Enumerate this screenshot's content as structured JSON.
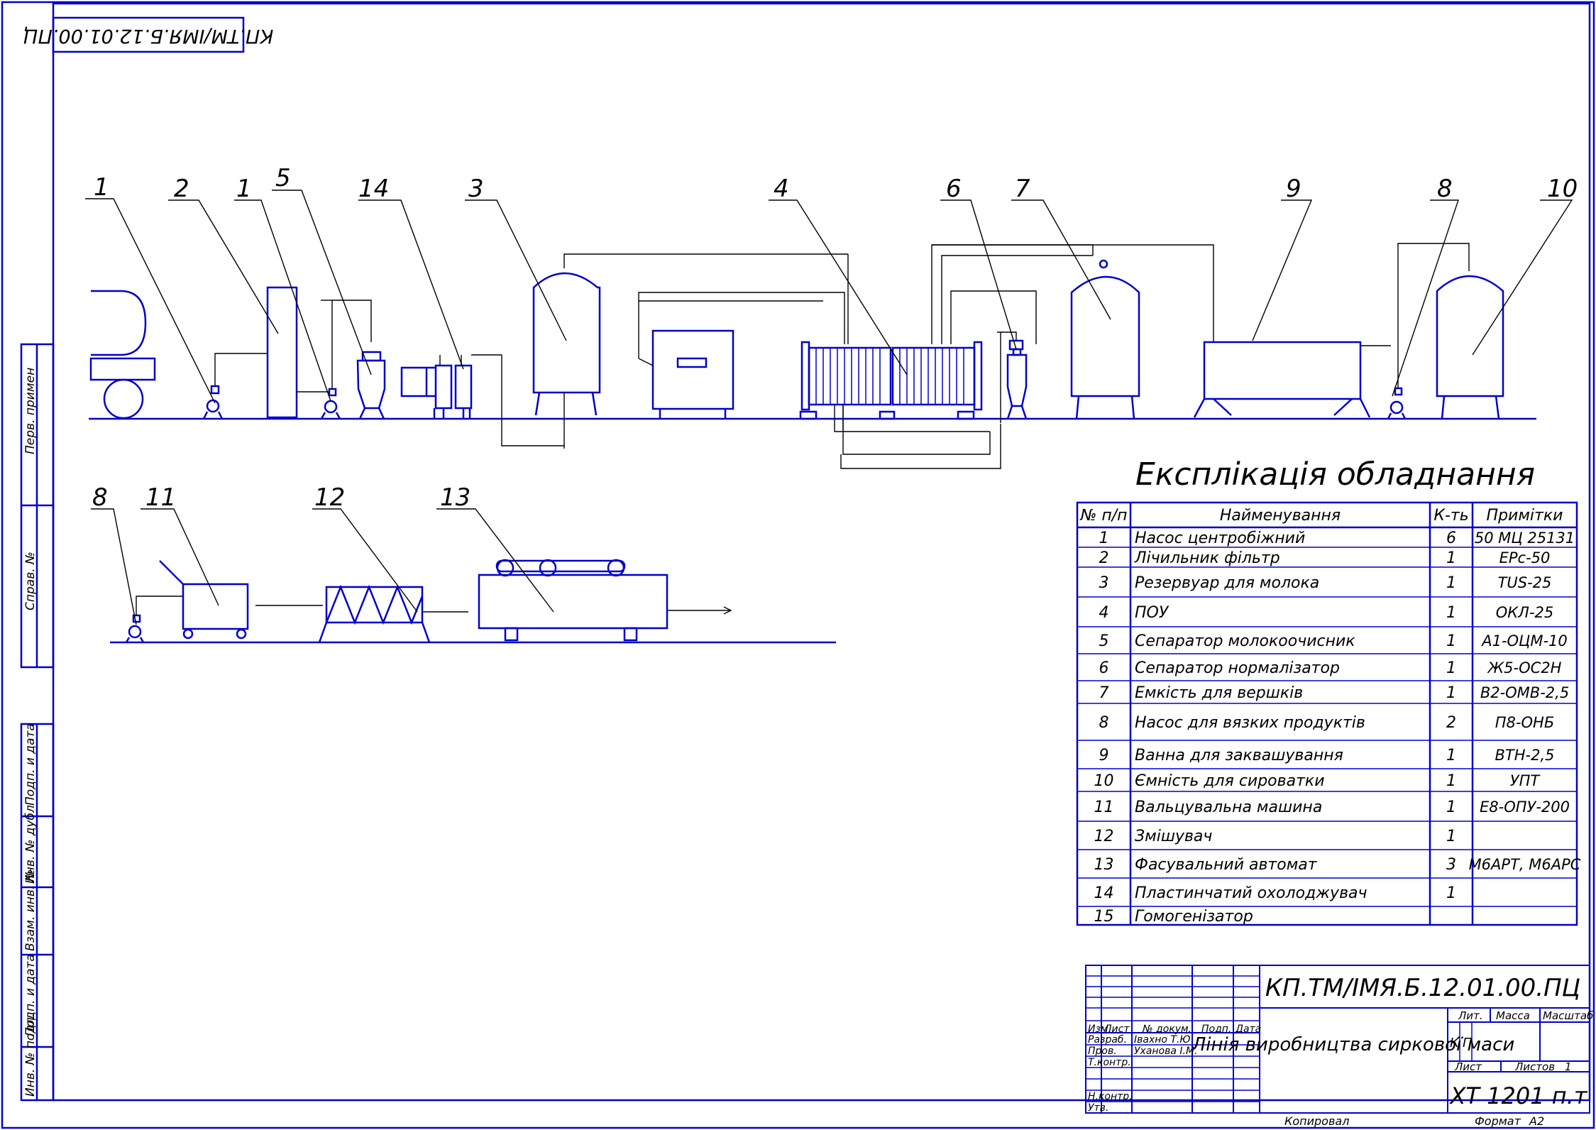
{
  "drawing": {
    "top_stamp": "КП.ТМ/ІМЯ.Б.12.01.00.ПЦ",
    "side_labels": [
      "Перв. примен",
      "Справ. №",
      "Подп. и дата",
      "Инв. № дубл",
      "Взам. инв. №",
      "Подп. и дата",
      "Инв. № подл."
    ],
    "callouts_row1": [
      "1",
      "2",
      "1",
      "5",
      "14",
      "3",
      "4",
      "6",
      "7",
      "9",
      "8",
      "10"
    ],
    "callouts_row2": [
      "8",
      "11",
      "12",
      "13"
    ],
    "footer_copied": "Копировал",
    "footer_format": "Формат",
    "footer_format_value": "А2"
  },
  "legend": {
    "title": "Експлікація обладнання",
    "headers": [
      "№ п/п",
      "Найменування",
      "К-ть",
      "Примітки"
    ],
    "rows": [
      {
        "n": "1",
        "name": "Насос центробіжний",
        "qty": "6",
        "note": "50 МЦ 25131"
      },
      {
        "n": "2",
        "name": "Лічильник фільтр",
        "qty": "1",
        "note": "ЕРс-50"
      },
      {
        "n": "3",
        "name": "Резервуар для молока",
        "qty": "1",
        "note": "TUS-25"
      },
      {
        "n": "4",
        "name": "ПОУ",
        "qty": "1",
        "note": "ОКЛ-25"
      },
      {
        "n": "5",
        "name": "Сепаратор молокоочисник",
        "qty": "1",
        "note": "А1-ОЦМ-10"
      },
      {
        "n": "6",
        "name": "Сепаратор нормалізатор",
        "qty": "1",
        "note": "Ж5-ОС2Н"
      },
      {
        "n": "7",
        "name": "Емкість для вершків",
        "qty": "1",
        "note": "В2-ОМВ-2,5"
      },
      {
        "n": "8",
        "name": "Насос для вязких продуктів",
        "qty": "2",
        "note": "П8-ОНБ"
      },
      {
        "n": "9",
        "name": "Ванна для заквашування",
        "qty": "1",
        "note": "ВТН-2,5"
      },
      {
        "n": "10",
        "name": "Ємність для сироватки",
        "qty": "1",
        "note": "УПТ"
      },
      {
        "n": "11",
        "name": "Вальцувальна машина",
        "qty": "1",
        "note": "Е8-ОПУ-200"
      },
      {
        "n": "12",
        "name": "Змішувач",
        "qty": "1",
        "note": ""
      },
      {
        "n": "13",
        "name": "Фасувальний автомат",
        "qty": "3",
        "note": "М6АРТ, М6АРС"
      },
      {
        "n": "14",
        "name": "Пластинчатий охолоджувач",
        "qty": "1",
        "note": ""
      },
      {
        "n": "15",
        "name": "Гомогенізатор",
        "qty": "",
        "note": ""
      }
    ]
  },
  "title_block": {
    "doc_code": "КП.ТМ/ІМЯ.Б.12.01.00.ПЦ",
    "title": "Лінія виробництва сиркової маси",
    "col_headers": [
      "Изм.",
      "Лист",
      "№ докум.",
      "Подп.",
      "Дата"
    ],
    "roles": [
      "Разраб.",
      "Пров.",
      "Т.контр.",
      "",
      "Н.контр.",
      "Утв."
    ],
    "names": [
      "Івахно Т.Ю",
      "Уханова І.М.",
      "",
      "",
      "",
      ""
    ],
    "lit_label": "Лит.",
    "mass_label": "Масса",
    "scale_label": "Масштаб",
    "lit_values": [
      "К",
      "П"
    ],
    "sheet_label": "Лист",
    "sheets_label": "Листов",
    "sheets_value": "1",
    "org": "ХТ 1201 п.т"
  }
}
